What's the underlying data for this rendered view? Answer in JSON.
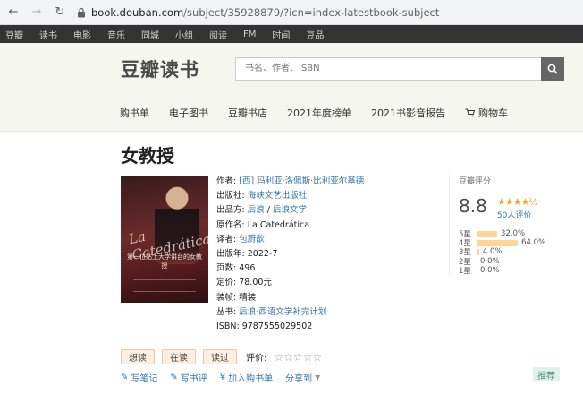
{
  "browser": {
    "domain": "book.douban.com",
    "path": "/subject/35928879/?icn=index-latestbook-subject"
  },
  "topnav": [
    "豆瓣",
    "读书",
    "电影",
    "音乐",
    "同城",
    "小组",
    "阅读",
    "FM",
    "时间",
    "豆品"
  ],
  "header": {
    "logo_part1": "豆瓣",
    "logo_part2": "读书",
    "search_placeholder": "书名、作者、ISBN"
  },
  "subnav": [
    "购书单",
    "电子图书",
    "豆瓣书店",
    "2021年度榜单",
    "2021书影音报告",
    "购物车"
  ],
  "book": {
    "title": "女教授",
    "cover_script": "La Catedrática",
    "cover_title": "第一位站上大学讲台的女教授",
    "author_label": "作者:",
    "author": "[西] 玛利亚·洛佩斯·比利亚尔基德",
    "publisher_label": "出版社:",
    "publisher": "海峡文艺出版社",
    "producer_label": "出品方:",
    "producer_a": "后浪",
    "producer_sep": " / ",
    "producer_b": "后浪文学",
    "original_label": "原作名:",
    "original": "La Catedrática",
    "translator_label": "译者:",
    "translator": "包蔚歆",
    "pubdate_label": "出版年:",
    "pubdate": "2022-7",
    "pages_label": "页数:",
    "pages": "496",
    "price_label": "定价:",
    "price": "78.00元",
    "binding_label": "装帧:",
    "binding": "精装",
    "series_label": "丛书:",
    "series": "后浪·西语文学补完计划",
    "isbn_label": "ISBN:",
    "isbn": "9787555029502"
  },
  "rating": {
    "title": "豆瓣评分",
    "score": "8.8",
    "stars_text": "★★★★½",
    "stars": 4.5,
    "count": "50人评价",
    "distribution": [
      {
        "label": "5星",
        "pct": "32.0%",
        "value": 32.0
      },
      {
        "label": "4星",
        "pct": "64.0%",
        "value": 64.0
      },
      {
        "label": "3星",
        "pct": "4.0%",
        "value": 4.0
      },
      {
        "label": "2星",
        "pct": "0.0%",
        "value": 0.0
      },
      {
        "label": "1星",
        "pct": "0.0%",
        "value": 0.0
      }
    ],
    "bar_color": "#ffd596"
  },
  "actions": {
    "want": "想读",
    "reading": "在读",
    "read": "读过",
    "rate_label": "评价:",
    "rate_stars": "☆☆☆☆☆"
  },
  "links": {
    "note": "写笔记",
    "review": "写书评",
    "cart": "加入购书单",
    "share": "分享到"
  },
  "recommend": "推荐",
  "colors": {
    "link": "#3377aa",
    "brand_green": "#3b7a4b",
    "star": "#f5a623"
  }
}
